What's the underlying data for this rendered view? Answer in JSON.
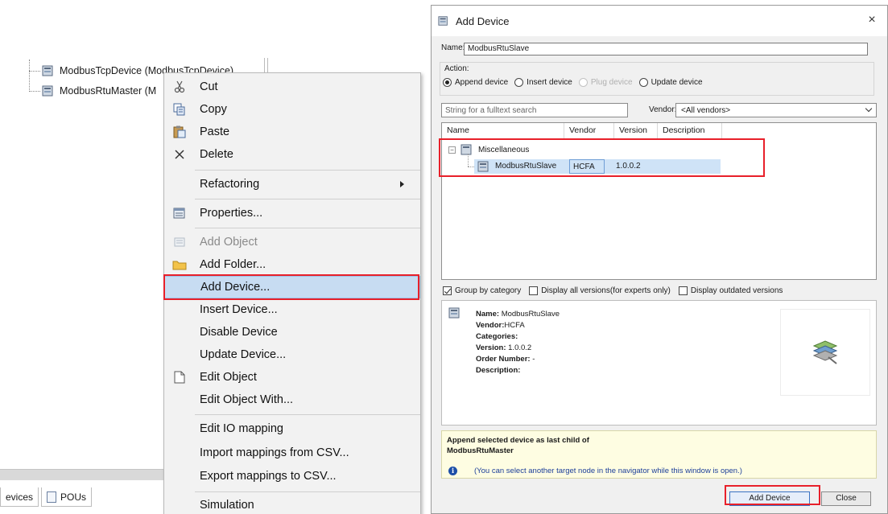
{
  "tree": {
    "items": [
      {
        "label": "ModbusTcpDevice (ModbusTcpDevice)"
      },
      {
        "label": "ModbusRtuMaster (M"
      }
    ]
  },
  "bottom_tabs": [
    {
      "label": "evices"
    },
    {
      "label": "POUs"
    }
  ],
  "context_menu": {
    "items": [
      {
        "label": "Cut",
        "icon": "scissors-icon"
      },
      {
        "label": "Copy",
        "icon": "copy-icon"
      },
      {
        "label": "Paste",
        "icon": "paste-icon"
      },
      {
        "label": "Delete",
        "icon": "delete-icon"
      },
      {
        "label": "Refactoring"
      },
      {
        "label": "Properties...",
        "icon": "properties-icon"
      },
      {
        "label": "Add Object",
        "icon": "add-object-icon"
      },
      {
        "label": "Add Folder...",
        "icon": "folder-icon"
      },
      {
        "label": "Add Device..."
      },
      {
        "label": "Insert Device..."
      },
      {
        "label": "Disable Device"
      },
      {
        "label": "Update Device..."
      },
      {
        "label": "Edit Object",
        "icon": "edit-object-icon"
      },
      {
        "label": "Edit Object With..."
      },
      {
        "label": "Edit IO mapping"
      },
      {
        "label": "Import mappings from CSV..."
      },
      {
        "label": "Export mappings to CSV..."
      },
      {
        "label": "Simulation"
      }
    ]
  },
  "dialog": {
    "title": "Add Device",
    "close": "×",
    "name_label": "Name:",
    "name_value": "ModbusRtuSlave",
    "action_label": "Action:",
    "actions": [
      {
        "label": "Append device",
        "selected": true
      },
      {
        "label": "Insert device"
      },
      {
        "label": "Plug device",
        "disabled": true
      },
      {
        "label": "Update device"
      }
    ],
    "search_placeholder": "String for a fulltext search",
    "vendor_label": "Vendor:",
    "vendor_value": "<All vendors>",
    "columns": [
      "Name",
      "Vendor",
      "Version",
      "Description"
    ],
    "category": "Miscellaneous",
    "device": {
      "name": "ModbusRtuSlave",
      "vendor": "HCFA",
      "version": "1.0.0.2"
    },
    "checkboxes": [
      {
        "label": "Group by category",
        "checked": true
      },
      {
        "label": "Display all versions(for experts only)",
        "checked": false
      },
      {
        "label": "Display outdated versions",
        "checked": false
      }
    ],
    "info": {
      "name_k": "Name:",
      "name_v": "ModbusRtuSlave",
      "vendor_k": "Vendor:",
      "vendor_v": "HCFA",
      "categories_k": "Categories:",
      "categories_v": "",
      "version_k": "Version:",
      "version_v": "1.0.0.2",
      "order_k": "Order Number:",
      "order_v": "-",
      "desc_k": "Description:",
      "desc_v": ""
    },
    "hint_line1": "Append selected device as last child of",
    "hint_line2": "ModbusRtuMaster",
    "hint_note": "(You can select another target node in the navigator while this window is open.)",
    "add_button": "Add Device",
    "close_button": "Close"
  },
  "colors": {
    "highlight_box": "#e8202a",
    "selection": "#c7dcf2"
  }
}
